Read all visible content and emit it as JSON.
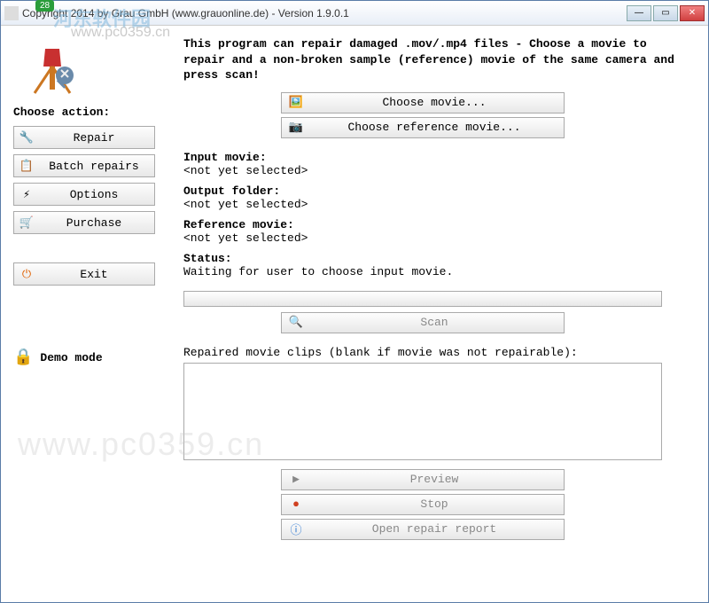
{
  "titlebar": {
    "title": "Copyright 2014 by Grau GmbH (www.grauonline.de) - Version 1.9.0.1",
    "badge": "28"
  },
  "watermarks": {
    "brand": "河东软件园",
    "url": "www.pc0359.cn",
    "big_url": "www.pc0359.cn"
  },
  "sidebar": {
    "heading": "Choose action:",
    "repair": "Repair",
    "batch": "Batch repairs",
    "options": "Options",
    "purchase": "Purchase",
    "exit": "Exit",
    "demo": "Demo mode"
  },
  "main": {
    "intro": "This program can repair damaged .mov/.mp4 files - Choose a movie to repair and a non-broken sample (reference) movie of the same camera and press scan!",
    "choose_movie": "Choose movie...",
    "choose_ref": "Choose reference movie...",
    "input_label": "Input movie:",
    "input_val": "<not yet selected>",
    "output_label": "Output folder:",
    "output_val": "<not yet selected>",
    "ref_label": "Reference movie:",
    "ref_val": "<not yet selected>",
    "status_label": "Status:",
    "status_val": "Waiting for user to choose input movie.",
    "scan": "Scan",
    "list_label": "Repaired movie clips (blank if movie was not repairable):",
    "preview": "Preview",
    "stop": "Stop",
    "report": "Open repair report"
  }
}
